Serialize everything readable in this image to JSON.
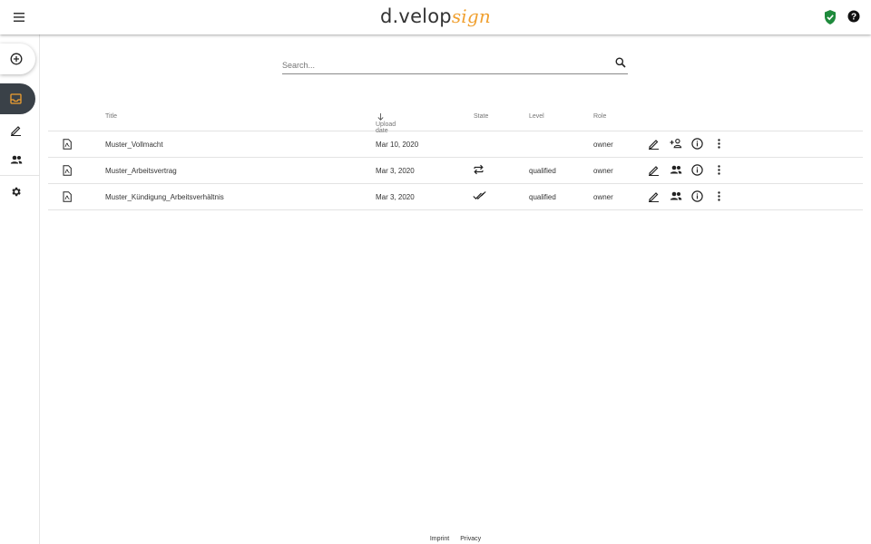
{
  "header": {
    "brand_main": "d.velop",
    "brand_accent": "sign",
    "icons": [
      "menu-icon",
      "shield-check-icon",
      "help-icon"
    ],
    "colors": {
      "accent": "#f0a030",
      "shield": "#1e8a3c",
      "sidebar_active": "#3a4148"
    }
  },
  "sidebar": {
    "items": [
      {
        "name": "add",
        "icon": "add-circle-icon"
      },
      {
        "name": "inbox",
        "icon": "inbox-icon",
        "active": true
      },
      {
        "name": "sign",
        "icon": "pen-icon"
      },
      {
        "name": "contacts",
        "icon": "people-icon"
      },
      {
        "name": "settings",
        "icon": "gear-icon"
      }
    ]
  },
  "search": {
    "placeholder": "Search...",
    "value": ""
  },
  "table": {
    "columns": {
      "title": "Title",
      "upload_date": "Upload date",
      "state": "State",
      "level": "Level",
      "role": "Role"
    },
    "rows": [
      {
        "title": "Muster_Vollmacht",
        "upload_date": "Mar 10, 2020",
        "state_icon": "",
        "level": "",
        "role": "owner",
        "share_icon": "add-person-icon"
      },
      {
        "title": "Muster_Arbeitsvertrag",
        "upload_date": "Mar 3, 2020",
        "state_icon": "repeat-icon",
        "level": "qualified",
        "role": "owner",
        "share_icon": "people-icon"
      },
      {
        "title": "Muster_Kündigung_Arbeitsverhältnis",
        "upload_date": "Mar 3, 2020",
        "state_icon": "done-all-icon",
        "level": "qualified",
        "role": "owner",
        "share_icon": "people-icon"
      }
    ]
  },
  "footer": {
    "imprint": "Imprint",
    "privacy": "Privacy"
  }
}
